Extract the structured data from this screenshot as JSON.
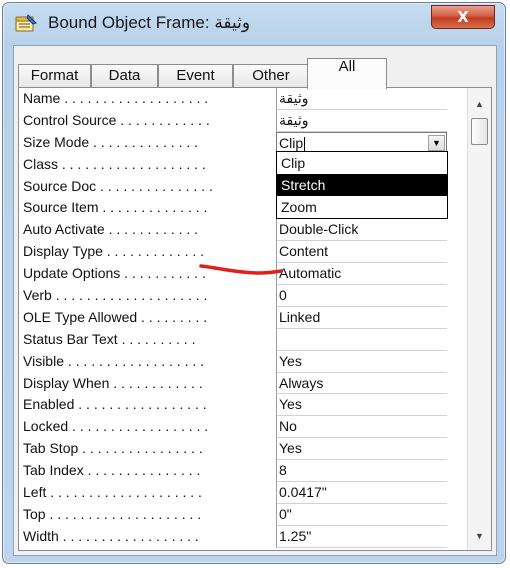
{
  "window": {
    "title": "Bound Object Frame: وثيقة",
    "close_label": "X",
    "title_icon": "property-sheet-icon"
  },
  "tabs": [
    {
      "label": "Format",
      "active": false
    },
    {
      "label": "Data",
      "active": false
    },
    {
      "label": "Event",
      "active": false
    },
    {
      "label": "Other",
      "active": false
    },
    {
      "label": "All",
      "active": true
    }
  ],
  "properties": [
    {
      "label": "Name . . . . . . . . . . . . . . . . . . .",
      "value": "وثيقة"
    },
    {
      "label": "Control Source . . . . . . . . . . . .",
      "value": "وثيقة"
    },
    {
      "label": "Size Mode . . . . . . . . . . . . . .",
      "value": "Clip"
    },
    {
      "label": "Class . . . . . . . . . . . . . . . . . . .",
      "value": ""
    },
    {
      "label": "Source Doc . . . . . . . . . . . . . . .",
      "value": ""
    },
    {
      "label": "Source Item . . . . . . . . . . . . . .",
      "value": ""
    },
    {
      "label": "Auto Activate . . . . . . . . . . . .",
      "value": "Double-Click"
    },
    {
      "label": "Display Type . . . . . . . . . . . . .",
      "value": "Content"
    },
    {
      "label": "Update Options . . . . . . . . . . .",
      "value": "Automatic"
    },
    {
      "label": "Verb . . . . . . . . . . . . . . . . . . . .",
      "value": "0"
    },
    {
      "label": "OLE Type Allowed . . . . . . . . .",
      "value": "Linked"
    },
    {
      "label": "Status Bar Text . . . . . . . . . .",
      "value": ""
    },
    {
      "label": "Visible . . . . . . . . . . . . . . . . . .",
      "value": "Yes"
    },
    {
      "label": "Display When . . . . . . . . . . . .",
      "value": "Always"
    },
    {
      "label": "Enabled . . . . . . . . . . . . . . . . .",
      "value": "Yes"
    },
    {
      "label": "Locked . . . . . . . . . . . . . . . . . .",
      "value": "No"
    },
    {
      "label": "Tab Stop . . . . . . . . . . . . . . . .",
      "value": "Yes"
    },
    {
      "label": "Tab Index . . . . . . . . . . . . . . .",
      "value": "8"
    },
    {
      "label": "Left . . . . . . . . . . . . . . . . . . . .",
      "value": "0.0417\""
    },
    {
      "label": "Top . . . . . . . . . . . . . . . . . . . .",
      "value": "0\""
    },
    {
      "label": "Width . . . . . . . . . . . . . . . . . .",
      "value": "1.25\""
    }
  ],
  "size_mode_dropdown": {
    "options": [
      "Clip",
      "Stretch",
      "Zoom"
    ],
    "highlighted": "Stretch"
  },
  "colors": {
    "annotation_red": "#e0201a",
    "selection_bg": "#000000"
  }
}
